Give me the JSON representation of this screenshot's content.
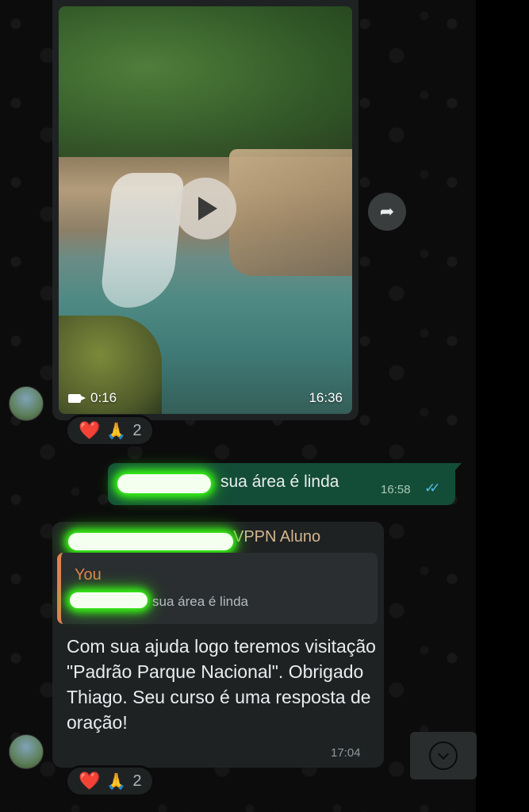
{
  "video_message": {
    "duration": "0:16",
    "time": "16:36"
  },
  "forward_icon": "forward-arrow-icon",
  "reactions_video": {
    "heart": "❤️",
    "pray": "🙏",
    "count": "2"
  },
  "outgoing_message": {
    "text": "sua área é linda",
    "time": "16:58",
    "ticks": "✓✓"
  },
  "incoming_reply": {
    "sender": "VPPN Aluno",
    "quote_author": "You",
    "quote_text": "sua área é linda",
    "body": "Com sua ajuda logo teremos visitação \"Padrão Parque Nacional\". Obrigado Thiago. Seu curso é uma resposta de oração!",
    "time": "17:04"
  },
  "reactions_reply": {
    "heart": "❤️",
    "pray": "🙏",
    "count": "2"
  },
  "colors": {
    "outgoing_bubble": "#144d37",
    "incoming_bubble": "#1f2223",
    "read_ticks": "#53bdeb",
    "quote_accent": "#e0834f",
    "sender_name": "#d3b68e"
  }
}
